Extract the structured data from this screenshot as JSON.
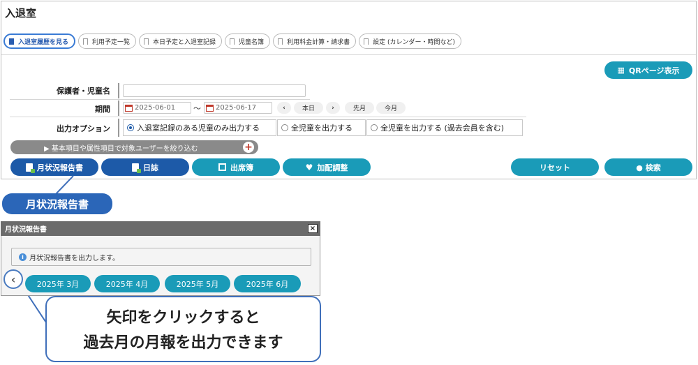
{
  "page": {
    "title": "入退室"
  },
  "tabs": [
    {
      "label": "入退室履歴を見る",
      "active": true
    },
    {
      "label": "利用予定一覧"
    },
    {
      "label": "本日予定と入退室記録"
    },
    {
      "label": "児童名簿"
    },
    {
      "label": "利用料金計算・請求書"
    },
    {
      "label": "設定 (カレンダー・時間など)"
    }
  ],
  "qr_button": {
    "label": "QRページ表示"
  },
  "form": {
    "guardian_label": "保護者・児童名",
    "guardian_value": "",
    "period_label": "期間",
    "date_from": "2025-06-01",
    "tilde": "～",
    "date_to": "2025-06-17",
    "nav_prev": "‹",
    "today": "本日",
    "nav_next": "›",
    "prev_month": "先月",
    "this_month": "今月",
    "output_label": "出力オプション",
    "options": [
      {
        "label": "入退室記録のある児童のみ出力する",
        "selected": true
      },
      {
        "label": "全児童を出力する"
      },
      {
        "label": "全児童を出力する (過去会員を含む)"
      }
    ],
    "filter_label": "▶ 基本項目や属性項目で対象ユーザーを絞り込む",
    "filter_plus": "+"
  },
  "actions": {
    "monthly_report": "月状況報告書",
    "diary": "日誌",
    "attendance": "出席簿",
    "adjustment": "加配調整",
    "reset": "リセット",
    "search": "● 検索"
  },
  "callout_label": "月状況報告書",
  "dialog": {
    "title": "月状況報告書",
    "close": "×",
    "info_icon": "i",
    "info": "月状況報告書を出力します。",
    "prev_arrow": "‹",
    "months": [
      "2025年 3月",
      "2025年 4月",
      "2025年 5月",
      "2025年 6月"
    ]
  },
  "bubble": {
    "line1": "矢印をクリックすると",
    "line2": "過去月の月報を出力できます"
  },
  "colors": {
    "teal": "#1a9bb8",
    "navy": "#1d5aa8",
    "callout": "#2b66b8"
  }
}
